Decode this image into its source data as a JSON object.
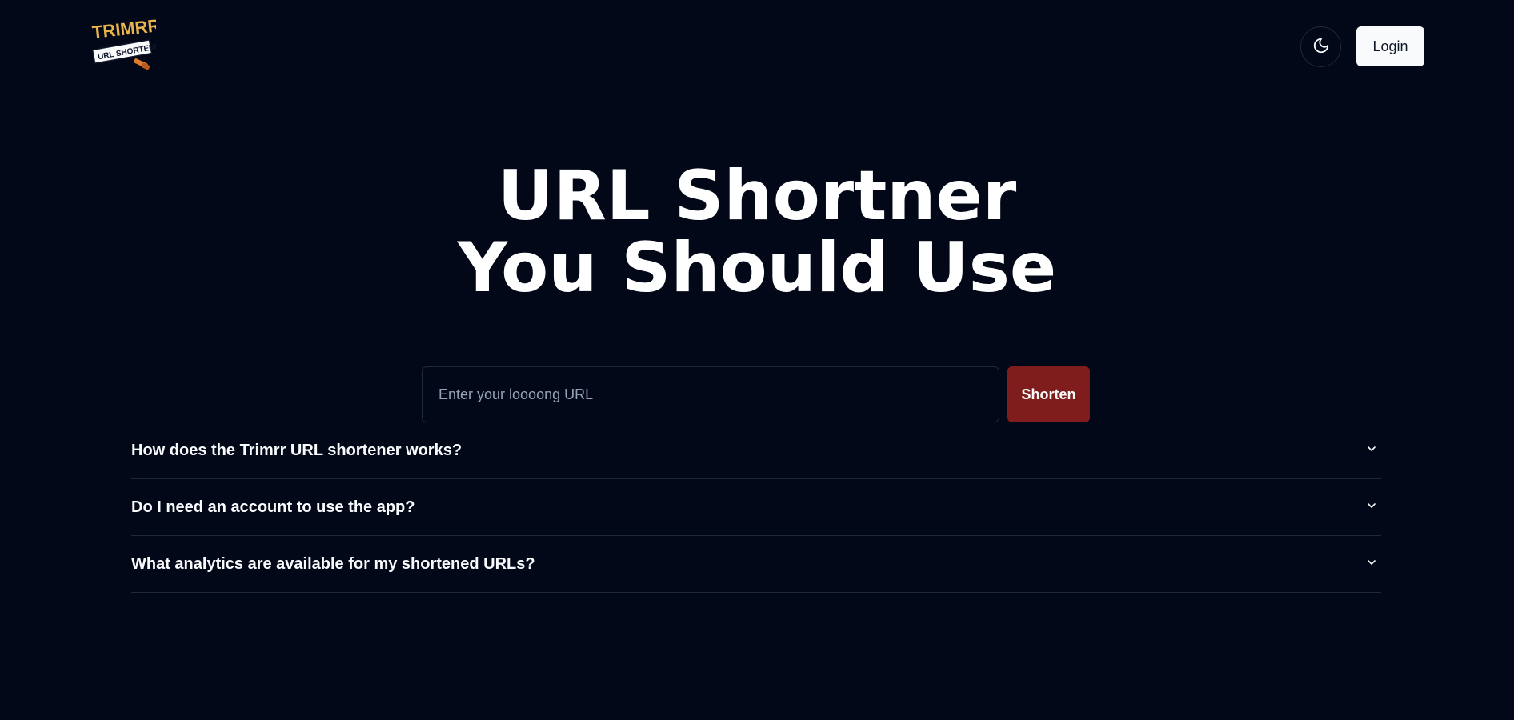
{
  "header": {
    "logo": {
      "brand_text": "TRIMRR",
      "sub_text": "URL SHORTENER",
      "icon": "trimrr-logo"
    },
    "theme_toggle_icon": "moon-icon",
    "login_label": "Login"
  },
  "hero": {
    "title_line1": "URL Shortner",
    "title_line2": "You Should Use"
  },
  "form": {
    "url_placeholder": "Enter your loooong URL",
    "url_value": "",
    "shorten_label": "Shorten"
  },
  "faq": {
    "items": [
      {
        "question": "How does the Trimrr URL shortener works?",
        "icon": "chevron-down-icon"
      },
      {
        "question": "Do I need an account to use the app?",
        "icon": "chevron-down-icon"
      },
      {
        "question": "What analytics are available for my shortened URLs?",
        "icon": "chevron-down-icon"
      }
    ]
  },
  "colors": {
    "background": "#020817",
    "accent": "#7f1d1d",
    "logo_gold": "#e9b44c",
    "border": "#1e293b"
  }
}
